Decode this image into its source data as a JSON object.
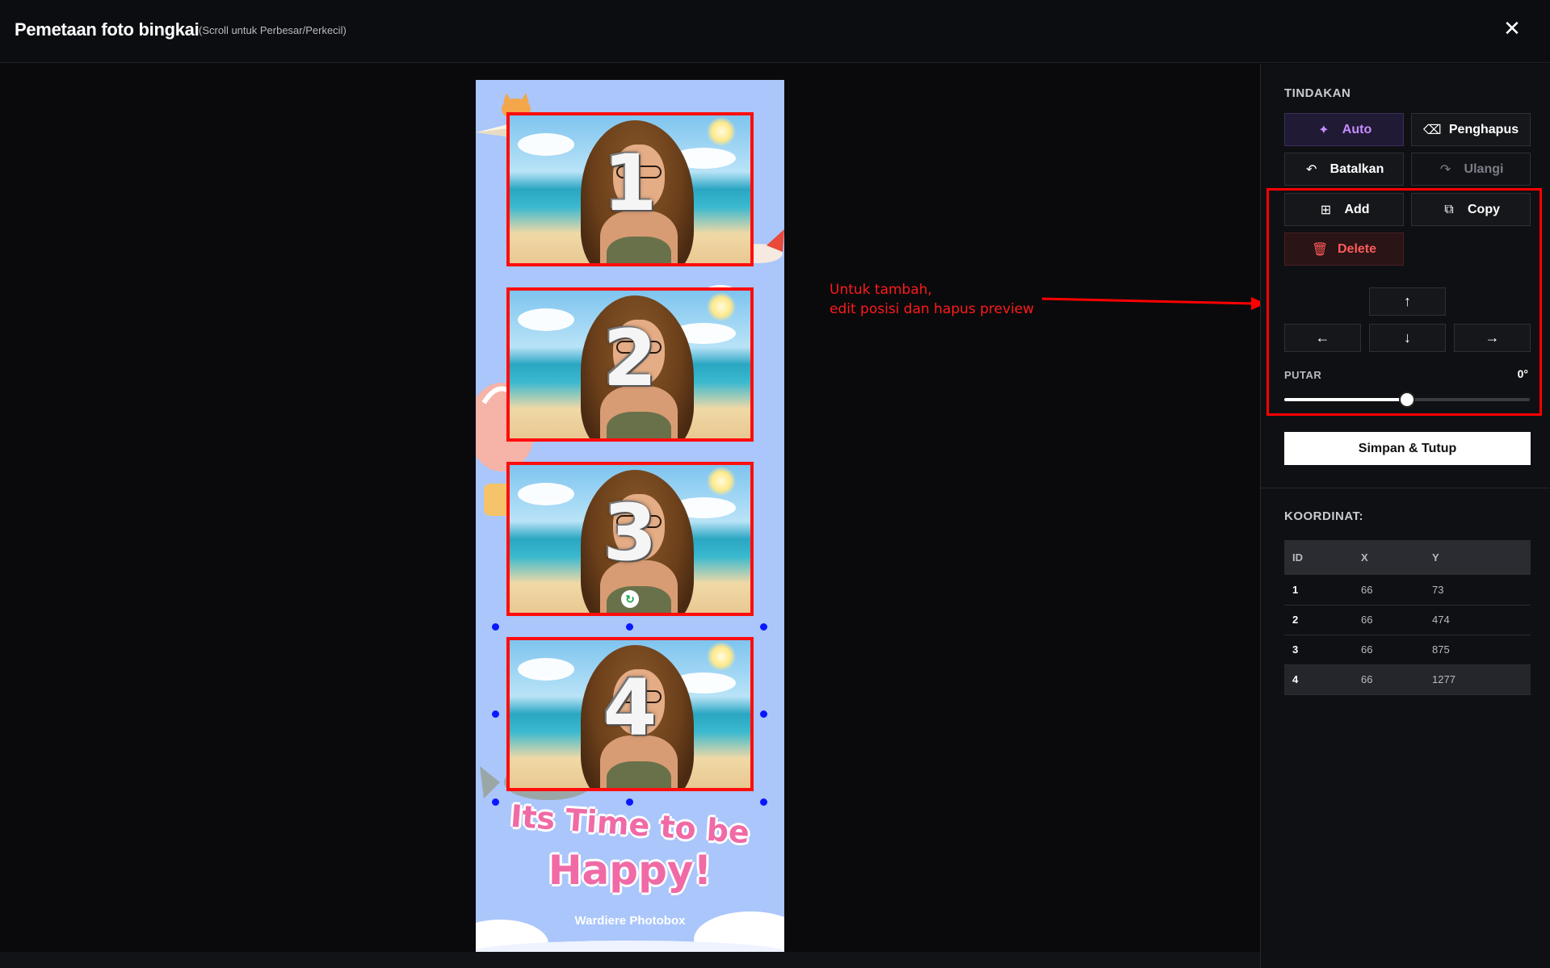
{
  "header": {
    "title": "Pemetaan foto bingkai",
    "subtitle": "(Scroll untuk Perbesar/Perkecil)",
    "close_label": "✕"
  },
  "canvas": {
    "photos": [
      {
        "number": "1"
      },
      {
        "number": "2"
      },
      {
        "number": "3"
      },
      {
        "number": "4"
      }
    ],
    "tagline_line1": "Its Time to be",
    "tagline_line2": "Happy!",
    "brand": "Wardiere Photobox",
    "annotation_line1": "Untuk tambah,",
    "annotation_line2": "edit posisi dan hapus preview"
  },
  "panel": {
    "actions_title": "TINDAKAN",
    "buttons": {
      "auto": "Auto",
      "eraser": "Penghapus",
      "undo": "Batalkan",
      "redo": "Ulangi",
      "add": "Add",
      "copy": "Copy",
      "delete": "Delete"
    },
    "arrows": {
      "up": "↑",
      "left": "←",
      "down": "↓",
      "right": "→"
    },
    "rotate_label": "PUTAR",
    "rotate_value": "0°",
    "rotate_fraction": 0.5,
    "save_label": "Simpan & Tutup",
    "coords_title": "KOORDINAT:",
    "table": {
      "headers": [
        "ID",
        "X",
        "Y"
      ],
      "rows": [
        {
          "id": "1",
          "x": "66",
          "y": "73"
        },
        {
          "id": "2",
          "x": "66",
          "y": "474"
        },
        {
          "id": "3",
          "x": "66",
          "y": "875"
        },
        {
          "id": "4",
          "x": "66",
          "y": "1277"
        }
      ],
      "active_row": 3
    }
  },
  "colors": {
    "accent_red": "#ff0d0d",
    "auto_purple": "#c58cff",
    "delete_red": "#ff5a5a",
    "frame_bg": "#aac6fb",
    "tagline_pink": "#f06aa6",
    "selection_blue": "#0a18ff"
  }
}
